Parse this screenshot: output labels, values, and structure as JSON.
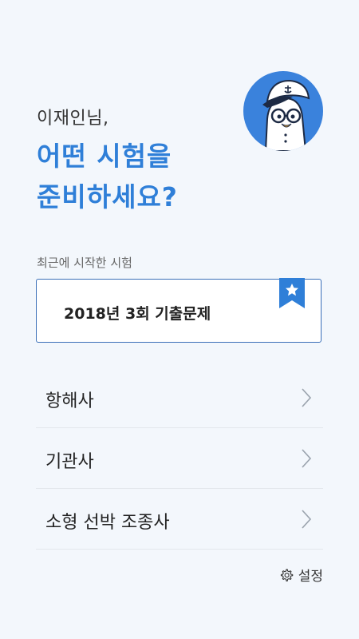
{
  "greeting": "이재인님,",
  "headline": {
    "line1": "어떤 시험을",
    "line2": "준비하세요?"
  },
  "colors": {
    "accent": "#2f7fd8",
    "avatar_bg": "#3a82dc",
    "card_border": "#3a6fb8",
    "background": "#f3f7fc"
  },
  "avatar": {
    "icon": "captain-mascot-icon"
  },
  "recent": {
    "label": "최근에 시작한 시험",
    "exam_title": "2018년 3회 기출문제",
    "bookmark_icon": "star-bookmark-icon"
  },
  "menu": {
    "items": [
      {
        "label": "항해사",
        "icon": "chevron-right-icon"
      },
      {
        "label": "기관사",
        "icon": "chevron-right-icon"
      },
      {
        "label": "소형 선박 조종사",
        "icon": "chevron-right-icon"
      }
    ]
  },
  "settings": {
    "label": "설정",
    "icon": "gear-icon"
  }
}
